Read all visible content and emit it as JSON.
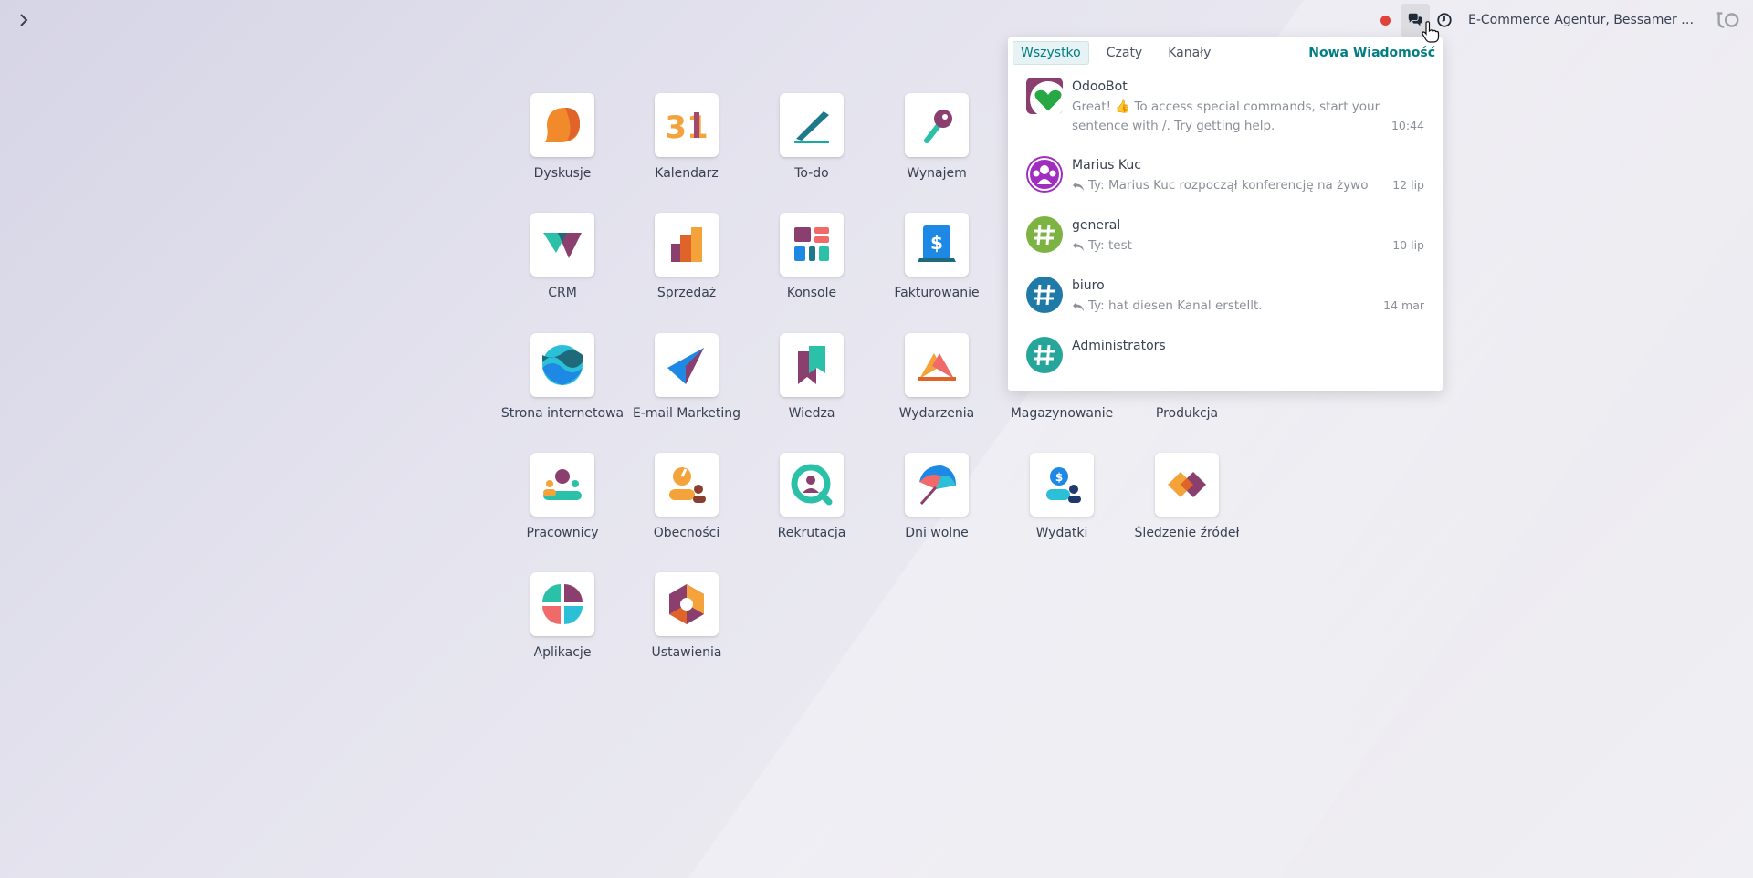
{
  "topbar": {
    "company": "E-Commerce Agentur, Bessamer Str..."
  },
  "apps": [
    {
      "label": "Dyskusje",
      "icon": "discuss-icon"
    },
    {
      "label": "Kalendarz",
      "icon": "calendar-icon",
      "glyph": "31"
    },
    {
      "label": "To-do",
      "icon": "todo-icon"
    },
    {
      "label": "Wynajem",
      "icon": "rental-icon"
    },
    {
      "label": "CRM",
      "icon": "crm-icon"
    },
    {
      "label": "Sprzedaż",
      "icon": "sales-icon"
    },
    {
      "label": "Konsole",
      "icon": "dashboards-icon"
    },
    {
      "label": "Fakturowanie",
      "icon": "invoicing-icon",
      "glyph": "$"
    },
    {
      "label": "Strona internetowa",
      "icon": "website-icon"
    },
    {
      "label": "E-mail Marketing",
      "icon": "email-marketing-icon"
    },
    {
      "label": "Wiedza",
      "icon": "knowledge-icon"
    },
    {
      "label": "Wydarzenia",
      "icon": "events-icon"
    },
    {
      "label": "Magazynowanie",
      "icon": "inventory-icon"
    },
    {
      "label": "Produkcja",
      "icon": "manufacturing-icon"
    },
    {
      "label": "Pracownicy",
      "icon": "employees-icon"
    },
    {
      "label": "Obecności",
      "icon": "attendances-icon"
    },
    {
      "label": "Rekrutacja",
      "icon": "recruitment-icon"
    },
    {
      "label": "Dni wolne",
      "icon": "time-off-icon"
    },
    {
      "label": "Wydatki",
      "icon": "expenses-icon",
      "glyph": "$"
    },
    {
      "label": "Śledzenie źródeł",
      "icon": "link-tracker-icon"
    },
    {
      "label": "Aplikacje",
      "icon": "apps-icon"
    },
    {
      "label": "Ustawienia",
      "icon": "settings-icon"
    }
  ],
  "messaging": {
    "filters": [
      "Wszystko",
      "Czaty",
      "Kanały"
    ],
    "active_filter": "Wszystko",
    "new_message": "Nowa Wiadomość",
    "items": [
      {
        "name": "OdooBot",
        "preview_lines": [
          "Great! 👍 To access special commands, start your",
          "sentence with /. Try getting help."
        ],
        "time": "10:44",
        "reply": false
      },
      {
        "name": "Marius Kuc",
        "preview": "Ty: Marius Kuc rozpoczął konferencję na żywo",
        "time": "12 lip",
        "reply": true
      },
      {
        "name": "general",
        "preview": "Ty: test",
        "time": "10 lip",
        "reply": true
      },
      {
        "name": "biuro",
        "preview": "Ty: hat diesen Kanal erstellt.",
        "time": "14 mar",
        "reply": true
      },
      {
        "name": "Administrators",
        "preview": "",
        "time": "",
        "reply": false
      }
    ]
  },
  "colors": {
    "accent": "#017e84",
    "record": "#e0433a"
  }
}
